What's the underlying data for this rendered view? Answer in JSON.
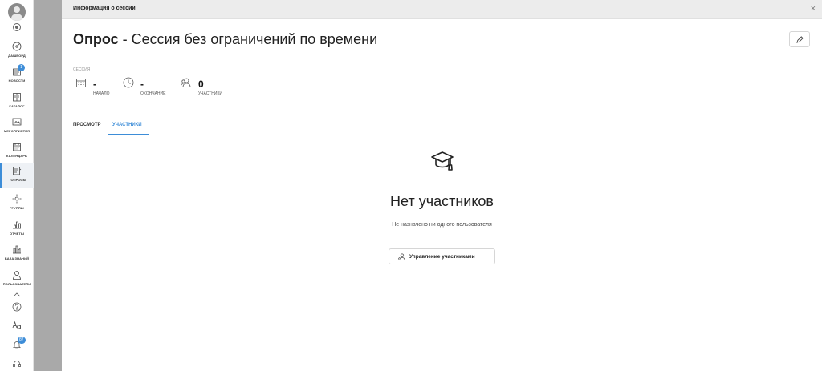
{
  "sidebar": {
    "items": [
      {
        "label": "Дашборд",
        "icon": "dashboard-icon"
      },
      {
        "label": "Новости",
        "icon": "news-icon",
        "badge": "1"
      },
      {
        "label": "Каталог",
        "icon": "catalog-icon"
      },
      {
        "label": "Мероприятия",
        "icon": "events-icon"
      },
      {
        "label": "Календарь",
        "icon": "calendar-icon"
      },
      {
        "label": "Опросы",
        "icon": "surveys-icon",
        "active": true
      },
      {
        "label": "Группы",
        "icon": "groups-icon"
      },
      {
        "label": "Отчеты",
        "icon": "reports-icon"
      },
      {
        "label": "База знаний",
        "icon": "knowledge-base-icon"
      },
      {
        "label": "Пользователи",
        "icon": "users-icon"
      }
    ],
    "notifications_badge": "87"
  },
  "panel": {
    "title": "Информация о сессии",
    "heading_strong": "Опрос",
    "heading_rest": " - Сессия без ограничений по времени",
    "session_label": "Сессия",
    "stats": {
      "start": {
        "value": "-",
        "label": "Начало"
      },
      "end": {
        "value": "-",
        "label": "Окончание"
      },
      "participants": {
        "value": "0",
        "label": "Участники"
      }
    },
    "tabs": {
      "preview": "Просмотр",
      "participants": "Участники"
    },
    "empty": {
      "title": "Нет участников",
      "subtitle": "Не назначено ни одного пользователя",
      "button": "Управление участниками"
    }
  },
  "colors": {
    "accent": "#3d8dd8",
    "backdrop": "#a9a9a9"
  }
}
